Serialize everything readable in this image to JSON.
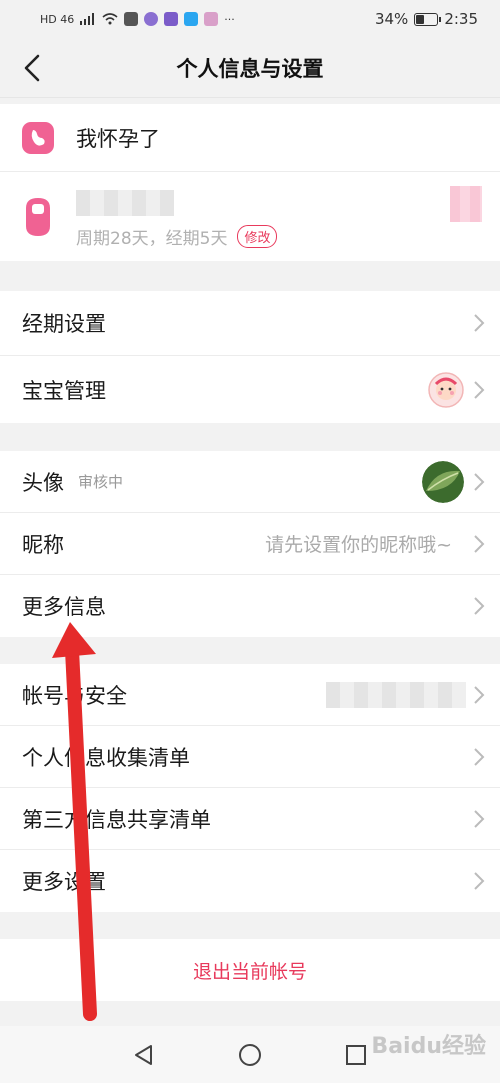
{
  "status_bar": {
    "left_text": "HD 46",
    "battery": "34%",
    "battery_level": 0.34,
    "time": "2:35",
    "more": "···"
  },
  "header": {
    "title": "个人信息与设置"
  },
  "status_section": {
    "pregnant_label": "我怀孕了",
    "period_info": "周期28天，经期5天",
    "edit_label": "修改"
  },
  "group1": {
    "items": [
      {
        "label": "经期设置"
      },
      {
        "label": "宝宝管理"
      }
    ]
  },
  "group2": {
    "avatar_label": "头像",
    "avatar_hint": "审核中",
    "nickname_label": "昵称",
    "nickname_placeholder": "请先设置你的昵称哦~",
    "more_info_label": "更多信息"
  },
  "group3": {
    "items": [
      {
        "label": "帐号与安全"
      },
      {
        "label": "个人信息收集清单"
      },
      {
        "label": "第三方信息共享清单"
      },
      {
        "label": "更多设置"
      }
    ]
  },
  "logout": {
    "label": "退出当前帐号"
  },
  "watermark": "Baidu经验",
  "colors": {
    "accent": "#e83a5c",
    "pink_icon": "#f06293",
    "arrow": "#e52b2b"
  },
  "icons": {
    "back": "chevron-left-icon",
    "chevron": "chevron-right-icon",
    "pregnant": "pregnant-icon",
    "period": "period-drop-icon"
  }
}
